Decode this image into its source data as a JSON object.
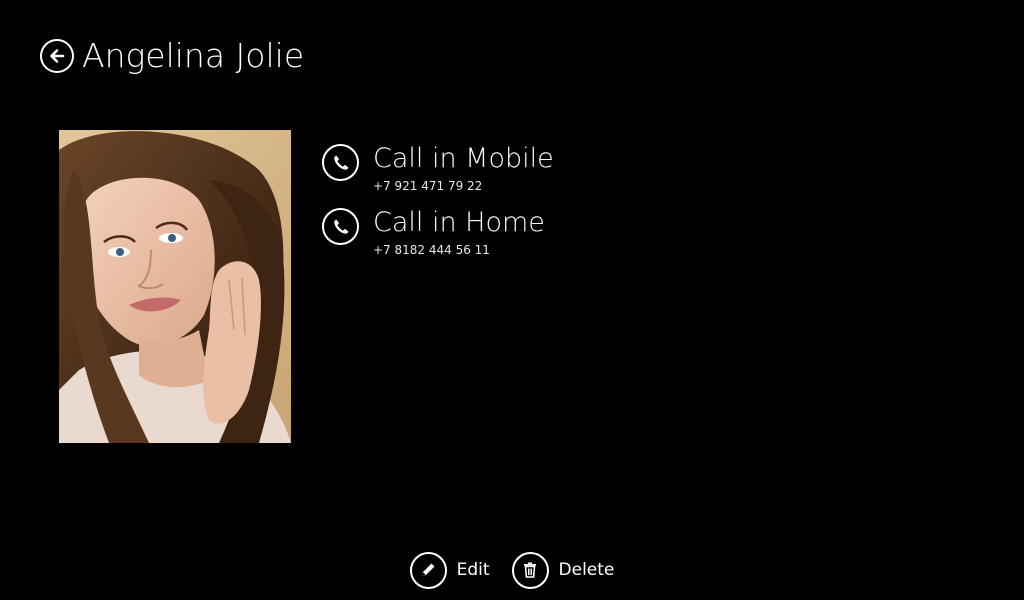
{
  "header": {
    "title": "Angelina Jolie",
    "back_icon": "back-arrow-icon"
  },
  "photo": {
    "description_icon": "contact-photo"
  },
  "phones": [
    {
      "label": "Call in Mobile",
      "number": "+7 921 471 79 22",
      "icon": "phone-icon"
    },
    {
      "label": "Call in Home",
      "number": "+7 8182 444 56 11",
      "icon": "phone-icon"
    }
  ],
  "app_bar": {
    "edit_label": "Edit",
    "edit_icon": "pencil-icon",
    "delete_label": "Delete",
    "delete_icon": "trash-icon"
  },
  "colors": {
    "background": "#000000",
    "foreground": "#ffffff"
  }
}
